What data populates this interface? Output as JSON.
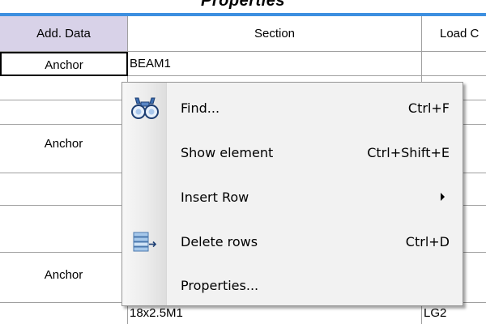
{
  "window": {
    "title": "Properties"
  },
  "grid": {
    "columns": [
      {
        "label": "Add. Data",
        "selected": true
      },
      {
        "label": "Section",
        "selected": false
      },
      {
        "label": "Load C",
        "selected": false
      }
    ],
    "rows": [
      {
        "add_data": "Anchor",
        "section": "BEAM1",
        "load": ""
      },
      {
        "add_data": "",
        "section": "",
        "load": ""
      },
      {
        "add_data": "",
        "section": "",
        "load": ""
      },
      {
        "add_data": "Anchor",
        "section": "",
        "load": ""
      },
      {
        "add_data": "",
        "section": "",
        "load": ""
      },
      {
        "add_data": "",
        "section": "",
        "load": ""
      },
      {
        "add_data": "Anchor",
        "section": "",
        "load": ""
      },
      {
        "add_data": "",
        "section": "18x2.5M1",
        "load": "LG2"
      }
    ]
  },
  "context_menu": {
    "items": [
      {
        "label": "Find...",
        "shortcut": "Ctrl+F",
        "icon": "binoculars-icon"
      },
      {
        "label": "Show element",
        "shortcut": "Ctrl+Shift+E",
        "icon": ""
      },
      {
        "label": "Insert Row",
        "shortcut": "",
        "icon": "",
        "submenu": true
      },
      {
        "label": "Delete rows",
        "shortcut": "Ctrl+D",
        "icon": "delete-rows-icon"
      },
      {
        "label": "Properties...",
        "shortcut": "",
        "icon": ""
      }
    ]
  },
  "colors": {
    "header_selected": "#d8d2e8",
    "title_accent": "#3d8fe0",
    "menu_bg": "#f2f2f2",
    "grid_line": "#a0a0a0"
  }
}
